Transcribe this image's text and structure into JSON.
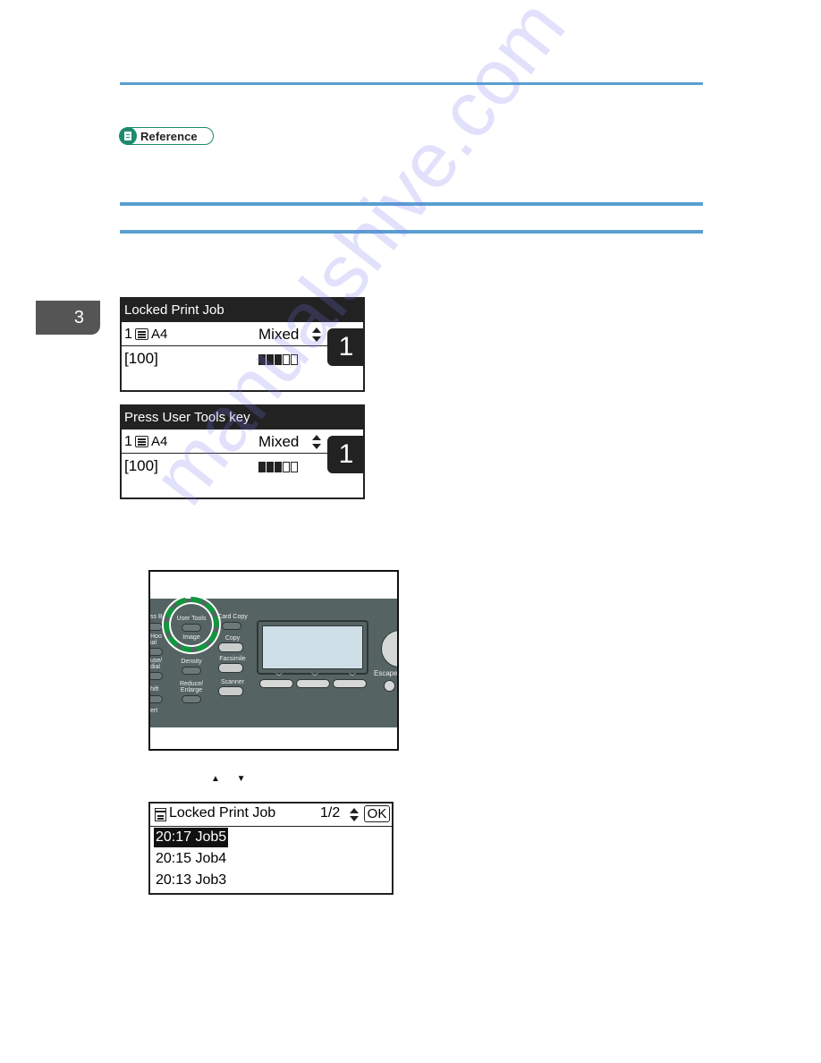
{
  "page": {
    "chapter_number": "3",
    "reference_label": "Reference",
    "watermark": "manualshive.com"
  },
  "lcd_screens": [
    {
      "title": "Locked Print Job",
      "quantity": "1",
      "paper_size": "A4",
      "mode": "Mixed",
      "copies": "[100]",
      "counter": "1",
      "density_level": 3,
      "density_max": 5
    },
    {
      "title": "Press User Tools key",
      "quantity": "1",
      "paper_size": "A4",
      "mode": "Mixed",
      "copies": "[100]",
      "counter": "1",
      "density_level": 3,
      "density_max": 5
    }
  ],
  "control_panel": {
    "highlighted_key": "User Tools",
    "labels": {
      "left_1": "ss B",
      "left_2": "Hoo\nial",
      "left_3": "use/\ndial",
      "left_4": "hift",
      "left_5": "ert",
      "user_tools": "User Tools",
      "image": "Image",
      "density": "Density",
      "reduce_enlarge": "Reduce/\nEnlarge",
      "card_copy": "Card Copy",
      "copy": "Copy",
      "facsimile": "Facsimile",
      "scanner": "Scanner",
      "escape": "Escape"
    },
    "accent_color": "#13963f"
  },
  "arrow_keys": "▲ ▼",
  "job_list_screen": {
    "title": "Locked Print Job",
    "page_indicator": "1/2",
    "ok_label": "OK",
    "jobs": [
      {
        "label": "20:17 Job5",
        "selected": true
      },
      {
        "label": "20:15 Job4",
        "selected": false
      },
      {
        "label": "20:13 Job3",
        "selected": false
      }
    ]
  },
  "colors": {
    "rule_blue": "#5a9fd0",
    "reference_green": "#1e8a6e",
    "chapter_tab_gray": "#555555",
    "panel_gray": "#566363"
  }
}
